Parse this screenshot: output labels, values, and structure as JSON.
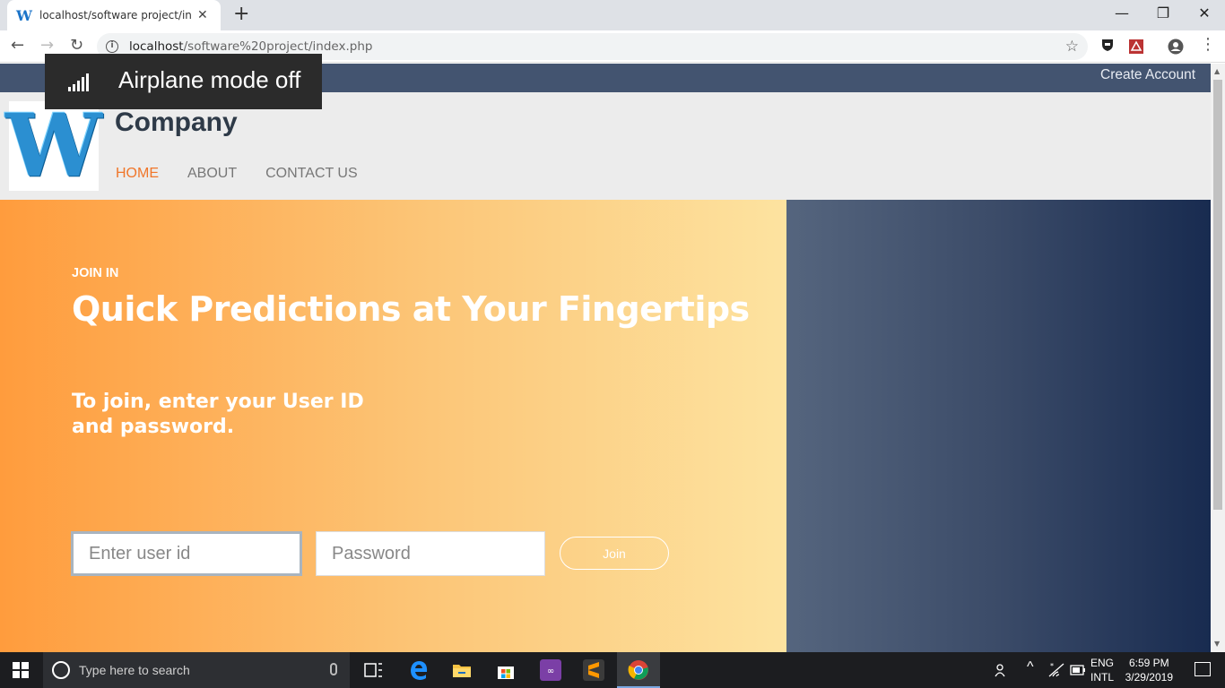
{
  "browser": {
    "tab_title": "localhost/software project/index.",
    "favicon_letter": "W",
    "url_host": "localhost",
    "url_path": "/software%20project/index.php"
  },
  "system_overlay": {
    "text": "Airplane mode off"
  },
  "topbar": {
    "create_account": "Create Account"
  },
  "header": {
    "logo_letter": "W",
    "company": "Company",
    "nav": [
      {
        "label": "HOME",
        "active": true
      },
      {
        "label": "ABOUT",
        "active": false
      },
      {
        "label": "CONTACT US",
        "active": false
      }
    ]
  },
  "hero": {
    "eyebrow": "JOIN IN",
    "title": "Quick Predictions at Your Fingertips",
    "subtitle": "To join, enter your User ID and password.",
    "userid_placeholder": "Enter user id",
    "password_placeholder": "Password",
    "join_label": "Join"
  },
  "taskbar": {
    "search_placeholder": "Type here to search",
    "lang_top": "ENG",
    "lang_bottom": "INTL",
    "time": "6:59 PM",
    "date": "3/29/2019"
  },
  "colors": {
    "accent_orange": "#f0762a",
    "topbar_blue": "#435470"
  }
}
